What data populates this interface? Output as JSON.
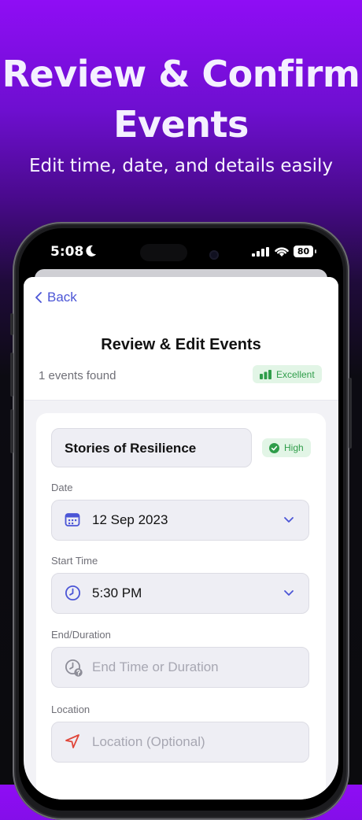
{
  "promo": {
    "headline_line1": "Review & Confirm",
    "headline_line2": "Events",
    "subtitle": "Edit time, date, and details easily"
  },
  "status_bar": {
    "time": "5:08",
    "battery": "80",
    "icons": [
      "moon-icon",
      "signal-icon",
      "wifi-icon",
      "battery-icon"
    ]
  },
  "nav": {
    "back_label": "Back"
  },
  "header": {
    "title": "Review & Edit Events",
    "events_found": "1 events found",
    "quality_badge": "Excellent"
  },
  "event": {
    "name": "Stories of Resilience",
    "confidence_badge": "High",
    "date_label": "Date",
    "date_value": "12 Sep 2023",
    "start_label": "Start Time",
    "start_value": "5:30 PM",
    "end_label": "End/Duration",
    "end_placeholder": "End Time or Duration",
    "location_label": "Location",
    "location_placeholder": "Location (Optional)"
  },
  "colors": {
    "accent": "#4b55d6",
    "success": "#2f9d4a",
    "location_icon": "#e0463a",
    "primary_button": "#5b48d9"
  }
}
